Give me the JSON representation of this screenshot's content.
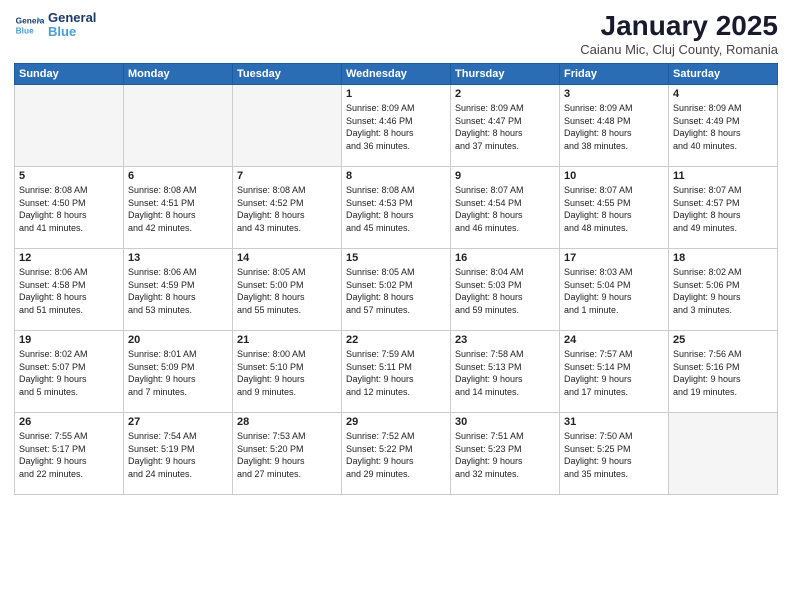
{
  "header": {
    "logo_line1": "General",
    "logo_line2": "Blue",
    "month": "January 2025",
    "location": "Caianu Mic, Cluj County, Romania"
  },
  "days_of_week": [
    "Sunday",
    "Monday",
    "Tuesday",
    "Wednesday",
    "Thursday",
    "Friday",
    "Saturday"
  ],
  "weeks": [
    [
      {
        "day": "",
        "info": ""
      },
      {
        "day": "",
        "info": ""
      },
      {
        "day": "",
        "info": ""
      },
      {
        "day": "1",
        "info": "Sunrise: 8:09 AM\nSunset: 4:46 PM\nDaylight: 8 hours\nand 36 minutes."
      },
      {
        "day": "2",
        "info": "Sunrise: 8:09 AM\nSunset: 4:47 PM\nDaylight: 8 hours\nand 37 minutes."
      },
      {
        "day": "3",
        "info": "Sunrise: 8:09 AM\nSunset: 4:48 PM\nDaylight: 8 hours\nand 38 minutes."
      },
      {
        "day": "4",
        "info": "Sunrise: 8:09 AM\nSunset: 4:49 PM\nDaylight: 8 hours\nand 40 minutes."
      }
    ],
    [
      {
        "day": "5",
        "info": "Sunrise: 8:08 AM\nSunset: 4:50 PM\nDaylight: 8 hours\nand 41 minutes."
      },
      {
        "day": "6",
        "info": "Sunrise: 8:08 AM\nSunset: 4:51 PM\nDaylight: 8 hours\nand 42 minutes."
      },
      {
        "day": "7",
        "info": "Sunrise: 8:08 AM\nSunset: 4:52 PM\nDaylight: 8 hours\nand 43 minutes."
      },
      {
        "day": "8",
        "info": "Sunrise: 8:08 AM\nSunset: 4:53 PM\nDaylight: 8 hours\nand 45 minutes."
      },
      {
        "day": "9",
        "info": "Sunrise: 8:07 AM\nSunset: 4:54 PM\nDaylight: 8 hours\nand 46 minutes."
      },
      {
        "day": "10",
        "info": "Sunrise: 8:07 AM\nSunset: 4:55 PM\nDaylight: 8 hours\nand 48 minutes."
      },
      {
        "day": "11",
        "info": "Sunrise: 8:07 AM\nSunset: 4:57 PM\nDaylight: 8 hours\nand 49 minutes."
      }
    ],
    [
      {
        "day": "12",
        "info": "Sunrise: 8:06 AM\nSunset: 4:58 PM\nDaylight: 8 hours\nand 51 minutes."
      },
      {
        "day": "13",
        "info": "Sunrise: 8:06 AM\nSunset: 4:59 PM\nDaylight: 8 hours\nand 53 minutes."
      },
      {
        "day": "14",
        "info": "Sunrise: 8:05 AM\nSunset: 5:00 PM\nDaylight: 8 hours\nand 55 minutes."
      },
      {
        "day": "15",
        "info": "Sunrise: 8:05 AM\nSunset: 5:02 PM\nDaylight: 8 hours\nand 57 minutes."
      },
      {
        "day": "16",
        "info": "Sunrise: 8:04 AM\nSunset: 5:03 PM\nDaylight: 8 hours\nand 59 minutes."
      },
      {
        "day": "17",
        "info": "Sunrise: 8:03 AM\nSunset: 5:04 PM\nDaylight: 9 hours\nand 1 minute."
      },
      {
        "day": "18",
        "info": "Sunrise: 8:02 AM\nSunset: 5:06 PM\nDaylight: 9 hours\nand 3 minutes."
      }
    ],
    [
      {
        "day": "19",
        "info": "Sunrise: 8:02 AM\nSunset: 5:07 PM\nDaylight: 9 hours\nand 5 minutes."
      },
      {
        "day": "20",
        "info": "Sunrise: 8:01 AM\nSunset: 5:09 PM\nDaylight: 9 hours\nand 7 minutes."
      },
      {
        "day": "21",
        "info": "Sunrise: 8:00 AM\nSunset: 5:10 PM\nDaylight: 9 hours\nand 9 minutes."
      },
      {
        "day": "22",
        "info": "Sunrise: 7:59 AM\nSunset: 5:11 PM\nDaylight: 9 hours\nand 12 minutes."
      },
      {
        "day": "23",
        "info": "Sunrise: 7:58 AM\nSunset: 5:13 PM\nDaylight: 9 hours\nand 14 minutes."
      },
      {
        "day": "24",
        "info": "Sunrise: 7:57 AM\nSunset: 5:14 PM\nDaylight: 9 hours\nand 17 minutes."
      },
      {
        "day": "25",
        "info": "Sunrise: 7:56 AM\nSunset: 5:16 PM\nDaylight: 9 hours\nand 19 minutes."
      }
    ],
    [
      {
        "day": "26",
        "info": "Sunrise: 7:55 AM\nSunset: 5:17 PM\nDaylight: 9 hours\nand 22 minutes."
      },
      {
        "day": "27",
        "info": "Sunrise: 7:54 AM\nSunset: 5:19 PM\nDaylight: 9 hours\nand 24 minutes."
      },
      {
        "day": "28",
        "info": "Sunrise: 7:53 AM\nSunset: 5:20 PM\nDaylight: 9 hours\nand 27 minutes."
      },
      {
        "day": "29",
        "info": "Sunrise: 7:52 AM\nSunset: 5:22 PM\nDaylight: 9 hours\nand 29 minutes."
      },
      {
        "day": "30",
        "info": "Sunrise: 7:51 AM\nSunset: 5:23 PM\nDaylight: 9 hours\nand 32 minutes."
      },
      {
        "day": "31",
        "info": "Sunrise: 7:50 AM\nSunset: 5:25 PM\nDaylight: 9 hours\nand 35 minutes."
      },
      {
        "day": "",
        "info": ""
      }
    ]
  ]
}
